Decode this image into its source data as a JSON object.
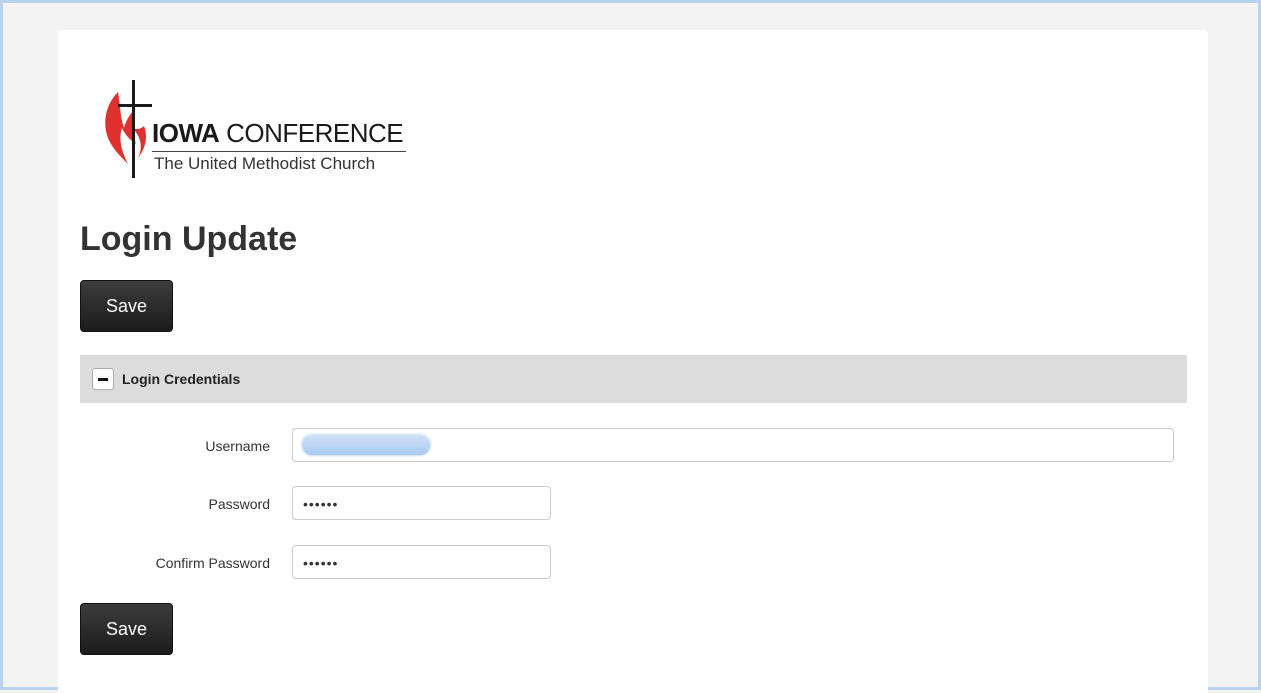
{
  "logo": {
    "line1_bold": "IOWA",
    "line1_rest": "CONFERENCE",
    "line2": "The United Methodist Church",
    "colors": {
      "flame": "#e0312f",
      "cross": "#1a1a1a"
    }
  },
  "page": {
    "title": "Login Update"
  },
  "buttons": {
    "save_top": "Save",
    "save_bottom": "Save"
  },
  "section": {
    "toggle_icon": "minus-icon",
    "title": "Login Credentials"
  },
  "form": {
    "username": {
      "label": "Username",
      "value": ""
    },
    "password": {
      "label": "Password",
      "value": "••••••"
    },
    "confirm_password": {
      "label": "Confirm Password",
      "value": "••••••"
    }
  }
}
